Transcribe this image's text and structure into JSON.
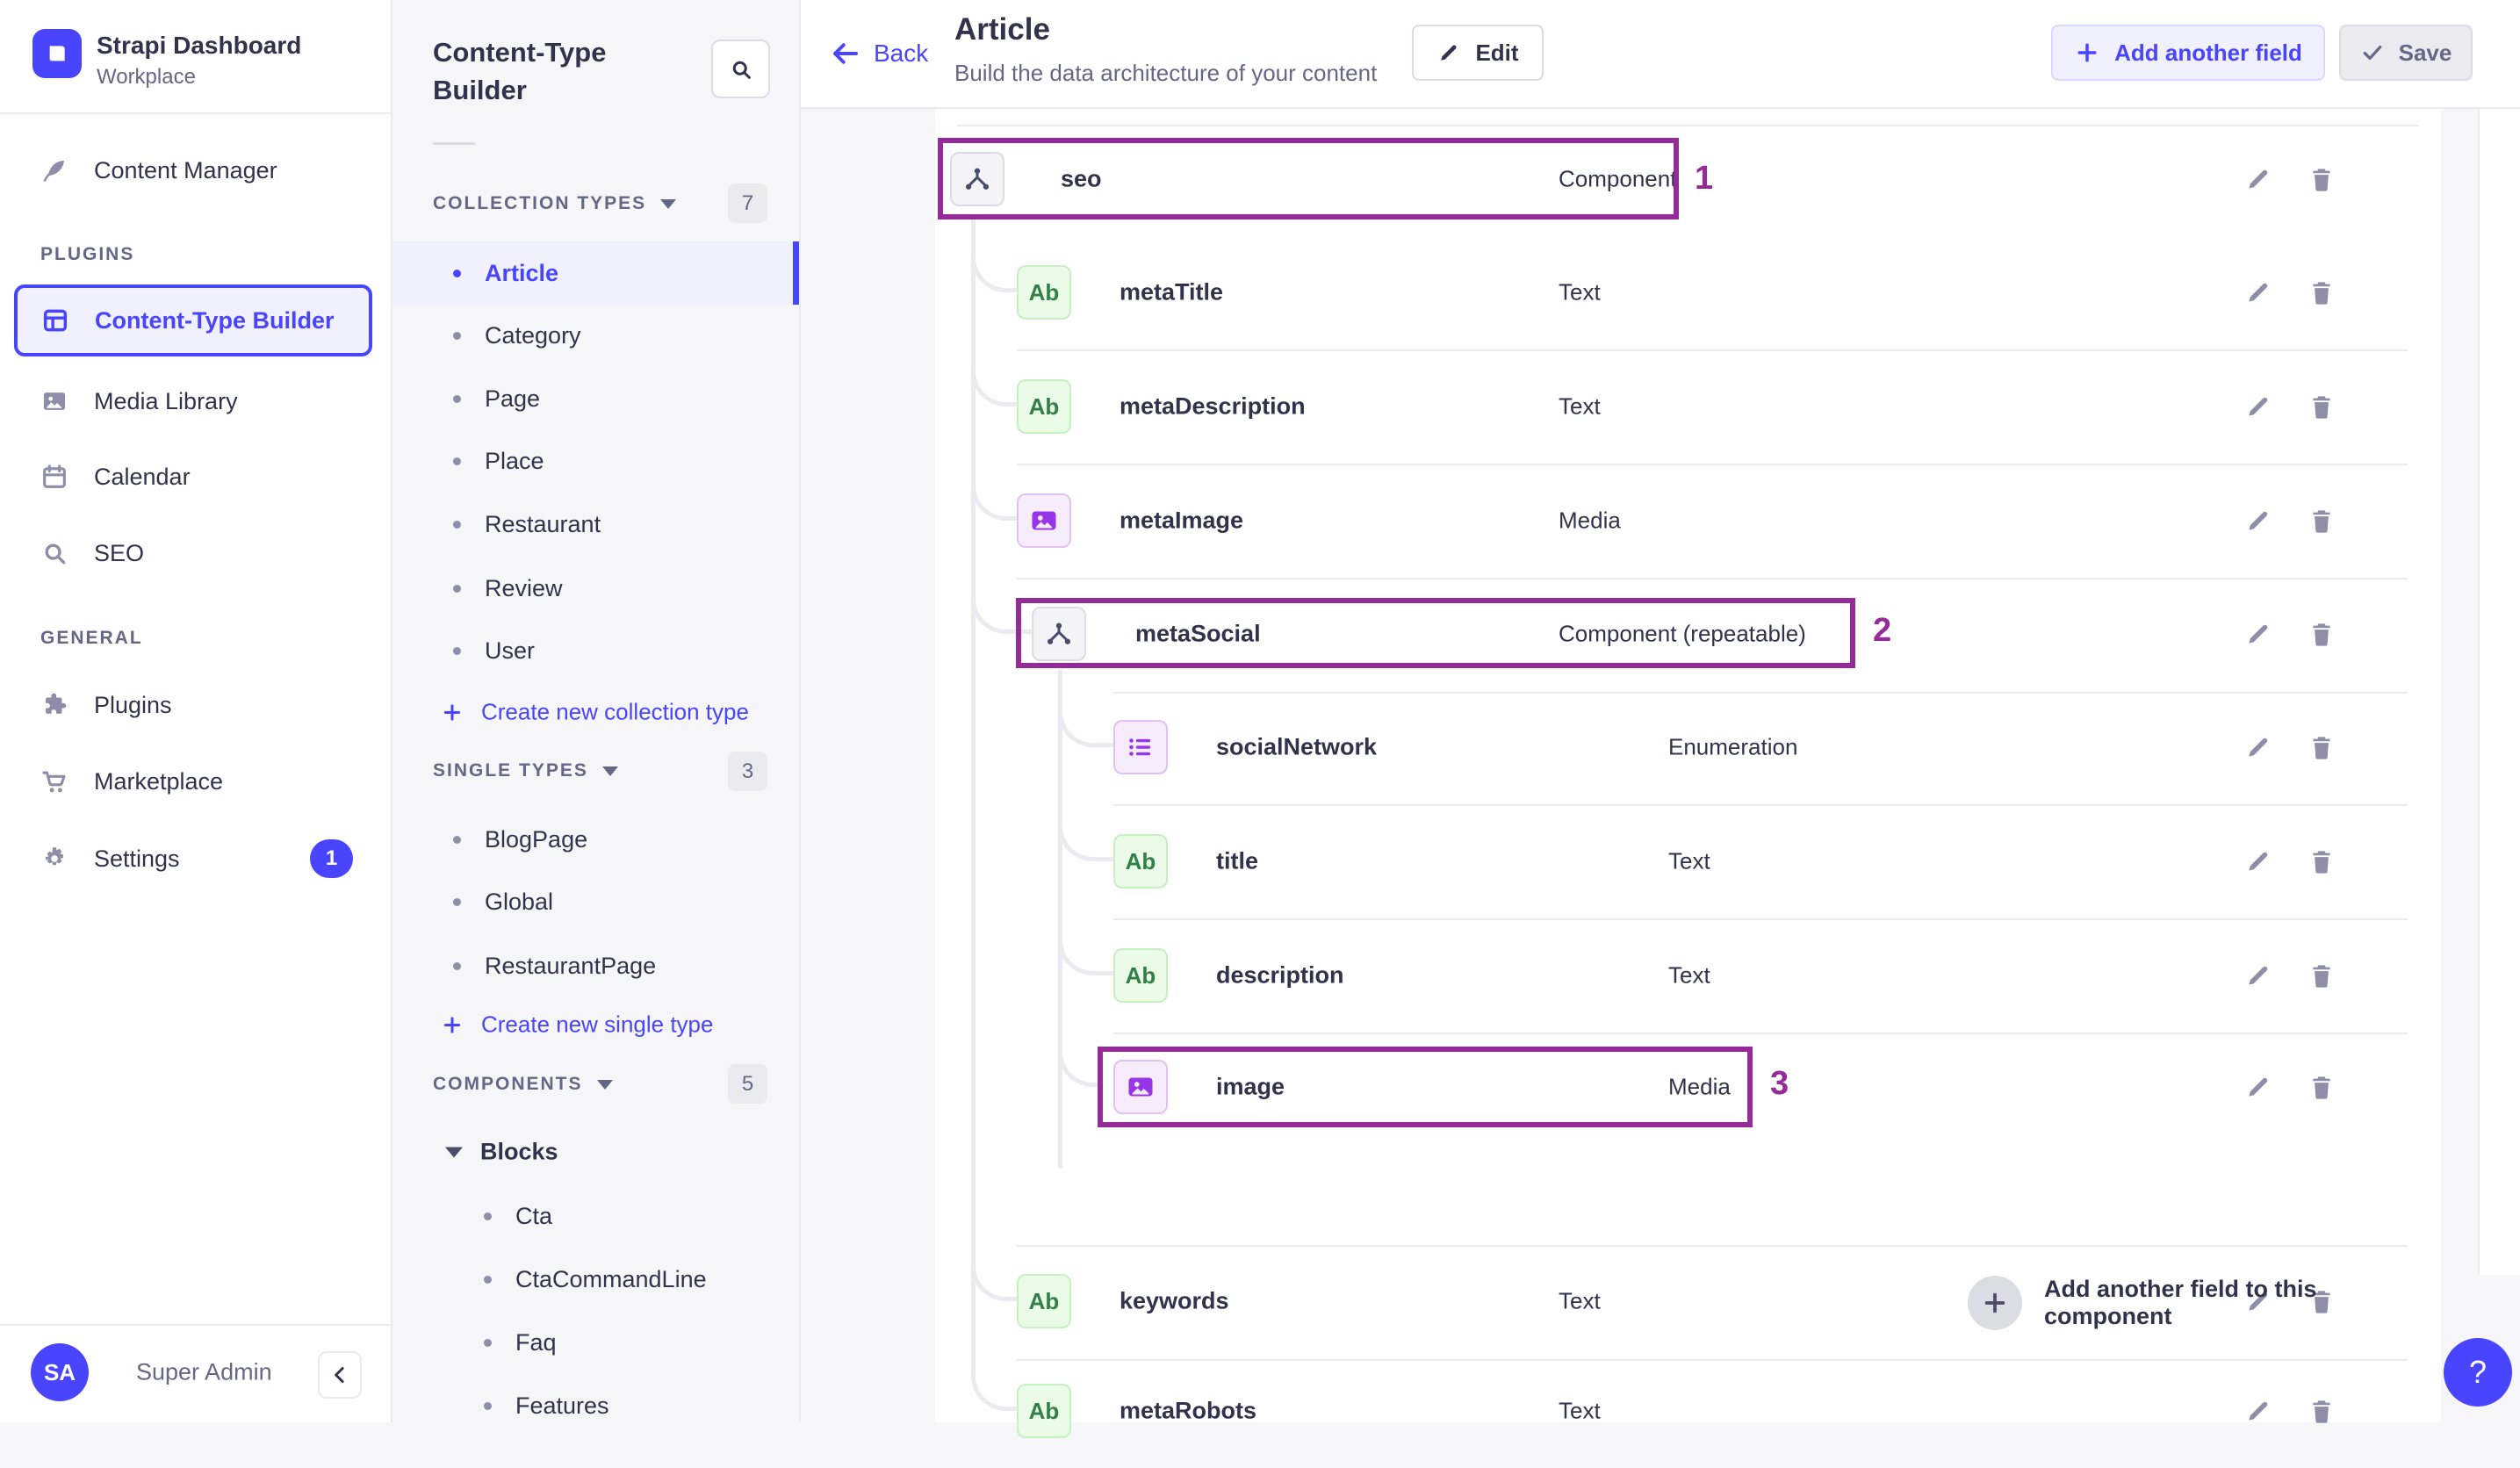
{
  "app": {
    "title": "Strapi Dashboard",
    "subtitle": "Workplace",
    "user": {
      "initials": "SA",
      "name": "Super Admin"
    },
    "help_label": "?"
  },
  "nav": {
    "plugins_section": "PLUGINS",
    "general_section": "GENERAL",
    "content_manager": "Content Manager",
    "content_type_builder": "Content-Type Builder",
    "media_library": "Media Library",
    "calendar": "Calendar",
    "seo": "SEO",
    "plugins": "Plugins",
    "marketplace": "Marketplace",
    "settings": "Settings",
    "settings_badge": "1"
  },
  "builder": {
    "title": "Content-Type Builder",
    "collection": {
      "label": "COLLECTION TYPES",
      "count": "7",
      "items": [
        "Article",
        "Category",
        "Page",
        "Place",
        "Restaurant",
        "Review",
        "User"
      ],
      "action": "Create new collection type"
    },
    "single": {
      "label": "SINGLE TYPES",
      "count": "3",
      "items": [
        "BlogPage",
        "Global",
        "RestaurantPage"
      ],
      "action": "Create new single type"
    },
    "components": {
      "label": "COMPONENTS",
      "count": "5",
      "group": "Blocks",
      "items": [
        "Cta",
        "CtaCommandLine",
        "Faq",
        "Features"
      ]
    }
  },
  "header": {
    "back": "Back",
    "title": "Article",
    "subtitle": "Build the data architecture of your content",
    "edit": "Edit",
    "add_field": "Add another field",
    "save": "Save"
  },
  "fields": {
    "text_badge": "Ab",
    "rows": [
      {
        "name": "seo",
        "type": "Component",
        "annotation": "1"
      },
      {
        "name": "metaTitle",
        "type": "Text"
      },
      {
        "name": "metaDescription",
        "type": "Text"
      },
      {
        "name": "metaImage",
        "type": "Media"
      },
      {
        "name": "metaSocial",
        "type": "Component (repeatable)",
        "annotation": "2"
      },
      {
        "name": "socialNetwork",
        "type": "Enumeration"
      },
      {
        "name": "title",
        "type": "Text"
      },
      {
        "name": "description",
        "type": "Text"
      },
      {
        "name": "image",
        "type": "Media",
        "annotation": "3"
      },
      {
        "name": "keywords",
        "type": "Text"
      },
      {
        "name": "metaRobots",
        "type": "Text"
      }
    ],
    "add_row": "Add another field to this component"
  },
  "colors": {
    "primary": "#4945FF",
    "annotation": "#942B99",
    "text_field": "#328048",
    "purple_field": "#9736E8"
  }
}
